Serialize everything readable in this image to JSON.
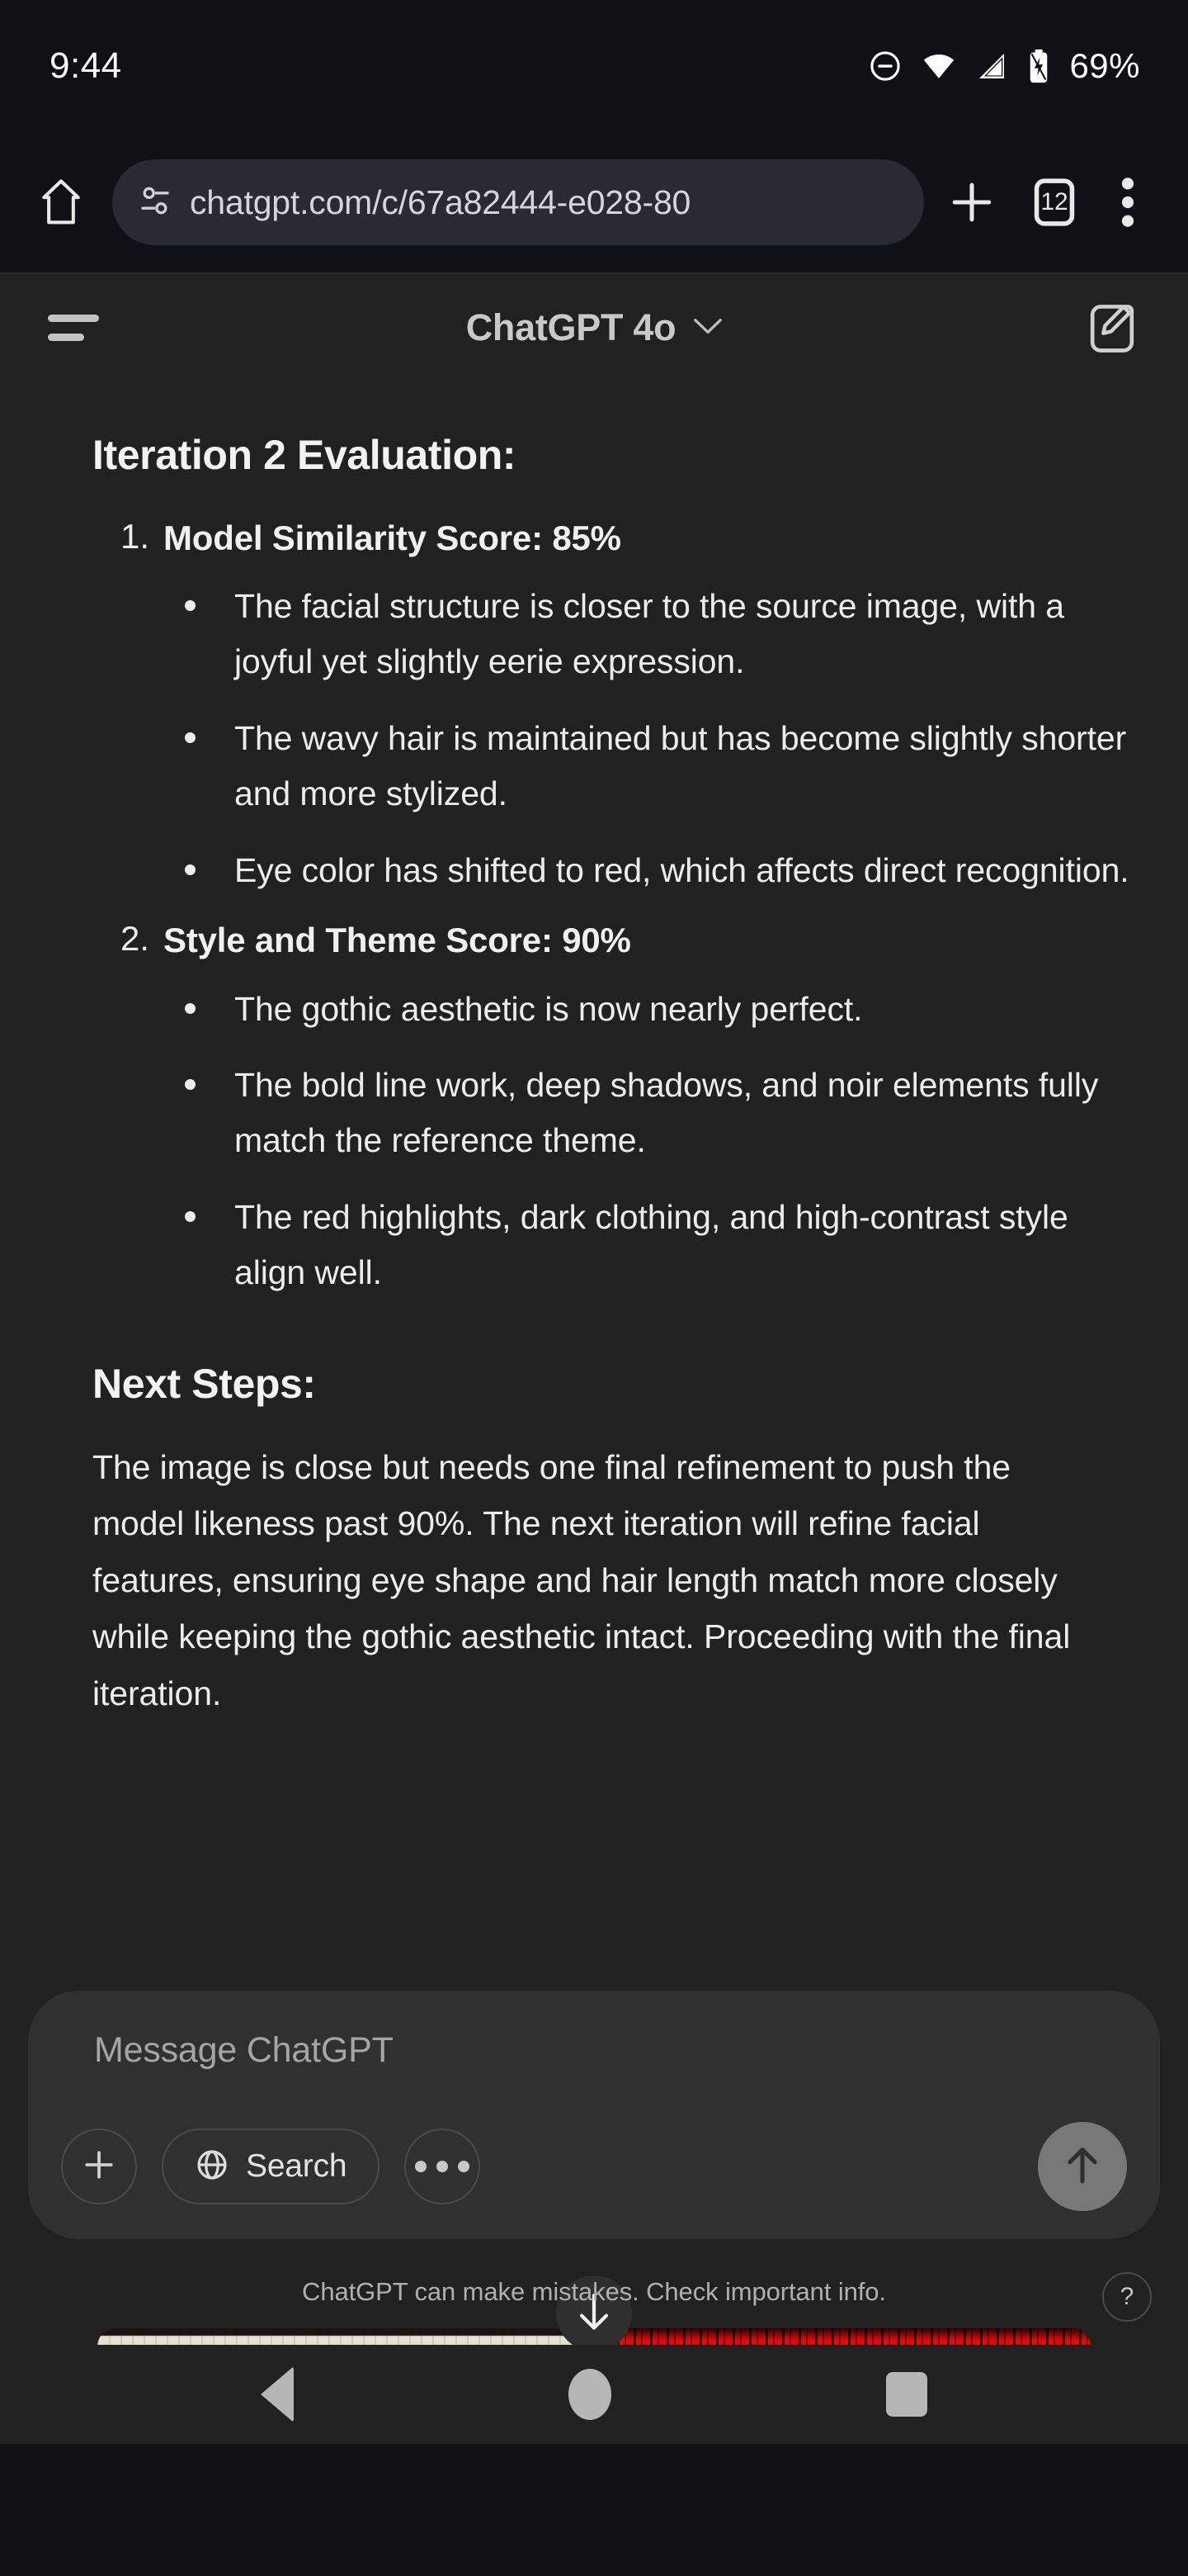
{
  "statusbar": {
    "time": "9:44",
    "battery_percent": "69%",
    "icons": [
      "do-not-disturb-icon",
      "wifi-icon",
      "cellular-signal-icon",
      "battery-charging-icon"
    ]
  },
  "browser": {
    "home_icon": "home-icon",
    "site_settings_icon": "site-settings-icon",
    "url": "chatgpt.com/c/67a82444-e028-80",
    "new_tab_icon": "plus-icon",
    "tab_count": "12",
    "overflow_icon": "three-dot-menu-icon"
  },
  "app_header": {
    "menu_icon": "hamburger-menu-icon",
    "title": "ChatGPT 4o",
    "chevron_icon": "chevron-down-icon",
    "compose_icon": "new-chat-compose-icon"
  },
  "conversation": {
    "heading_1": "Iteration 2 Evaluation:",
    "items": [
      {
        "number": "1.",
        "title": "Model Similarity Score: 85%",
        "bullets": [
          "The facial structure is closer to the source image, with a joyful yet slightly eerie expression.",
          "The wavy hair is maintained but has become slightly shorter and more stylized.",
          "Eye color has shifted to red, which affects direct recognition."
        ]
      },
      {
        "number": "2.",
        "title": "Style and Theme Score: 90%",
        "bullets": [
          "The gothic aesthetic is now nearly perfect.",
          "The bold line work, deep shadows, and noir elements fully match the reference theme.",
          "The red highlights, dark clothing, and high-contrast style align well."
        ]
      }
    ],
    "heading_2": "Next Steps:",
    "paragraph": "The image is close but needs one final refinement to push the model likeness past 90%. The next iteration will refine facial features, ensuring eye shape and hair length match more closely while keeping the gothic aesthetic intact. Proceeding with the final iteration.",
    "scroll_down_icon": "arrow-down-icon",
    "attachments": [
      {
        "name": "generated-image-sepia",
        "alt": "sepia gothic portrait crop"
      },
      {
        "name": "generated-image-red",
        "alt": "red gothic portrait crop"
      }
    ]
  },
  "composer": {
    "placeholder": "Message ChatGPT",
    "add_icon": "plus-icon",
    "search_icon": "globe-icon",
    "search_label": "Search",
    "more_icon": "ellipsis-icon",
    "send_icon": "arrow-up-icon"
  },
  "footer": {
    "disclaimer": "ChatGPT can make mistakes. Check important info.",
    "help_label": "?"
  },
  "navbar": {
    "back": "back-triangle-icon",
    "home": "home-circle-icon",
    "recents": "recents-square-icon"
  },
  "colors": {
    "system_bg": "#0f1117",
    "app_bg": "#212121",
    "composer_bg": "#303030",
    "url_pill_bg": "#282b33",
    "text_primary": "#ececec",
    "text_muted": "#a5a5a5",
    "send_btn": "#787878",
    "image_red": "#e20b0b"
  }
}
